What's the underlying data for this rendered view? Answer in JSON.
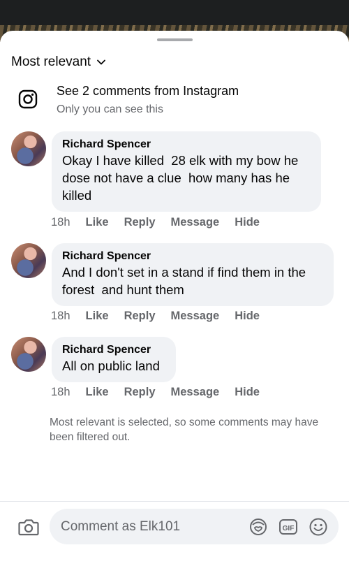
{
  "sort": {
    "label": "Most relevant",
    "icon": "chevron-down-icon"
  },
  "instagram": {
    "title": "See 2 comments from Instagram",
    "subtitle": "Only you can see this",
    "icon": "instagram-icon"
  },
  "comments": [
    {
      "author": "Richard Spencer",
      "text": "Okay I have killed  28 elk with my bow he\ndose not have a clue  how many has he\nkilled",
      "time": "18h",
      "like": "Like",
      "reply": "Reply",
      "message": "Message",
      "hide": "Hide"
    },
    {
      "author": "Richard Spencer",
      "text": "And I don't set in a stand if find them in the\nforest  and hunt them",
      "time": "18h",
      "like": "Like",
      "reply": "Reply",
      "message": "Message",
      "hide": "Hide"
    },
    {
      "author": "Richard Spencer",
      "text": "All on public land",
      "time": "18h",
      "like": "Like",
      "reply": "Reply",
      "message": "Message",
      "hide": "Hide"
    }
  ],
  "filter_note": "Most relevant is selected, so some comments may have been filtered out.",
  "composer": {
    "placeholder": "Comment as Elk101",
    "icons": [
      "camera-icon",
      "avatar-sticker-icon",
      "gif-icon",
      "emoji-icon"
    ]
  },
  "colors": {
    "bubble": "#f0f2f5",
    "secondary_text": "#65676b",
    "primary_text": "#050505"
  }
}
